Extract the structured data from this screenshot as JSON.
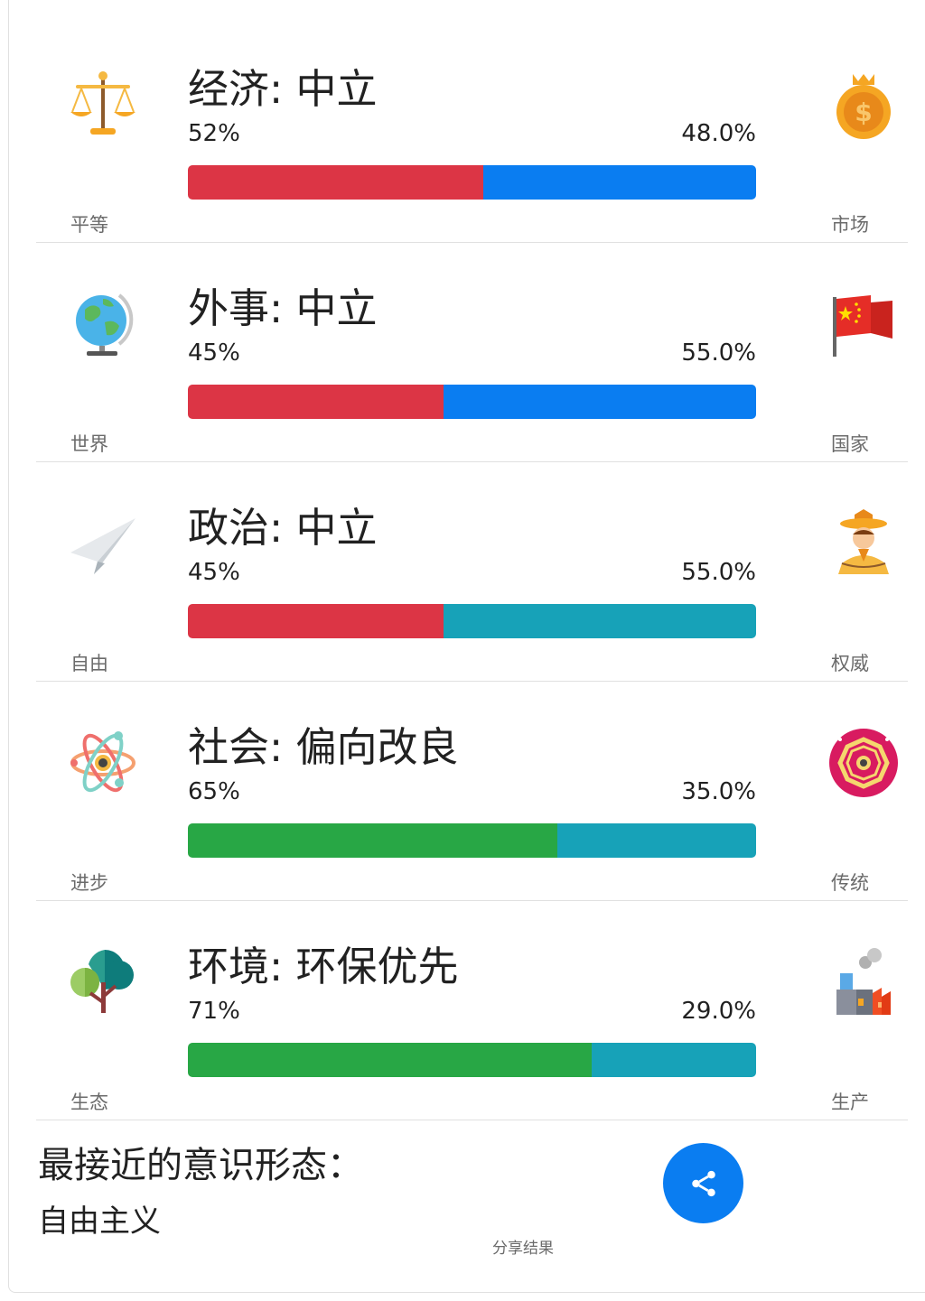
{
  "colors": {
    "red": "#dc3545",
    "blue": "#0a7df1",
    "teal": "#17a2b8",
    "green": "#28a745"
  },
  "axes": [
    {
      "title": "经济: 中立",
      "left_pct": "52%",
      "right_pct": "48.0%",
      "left_value": 52,
      "left_label": "平等",
      "right_label": "市场",
      "left_icon": "scales-icon",
      "right_icon": "money-bag-icon",
      "left_color": "#dc3545",
      "right_color": "#0a7df1"
    },
    {
      "title": "外事: 中立",
      "left_pct": "45%",
      "right_pct": "55.0%",
      "left_value": 45,
      "left_label": "世界",
      "right_label": "国家",
      "left_icon": "globe-icon",
      "right_icon": "flag-icon",
      "left_color": "#dc3545",
      "right_color": "#0a7df1"
    },
    {
      "title": "政治: 中立",
      "left_pct": "45%",
      "right_pct": "55.0%",
      "left_value": 45,
      "left_label": "自由",
      "right_label": "权威",
      "left_icon": "paper-plane-icon",
      "right_icon": "emperor-icon",
      "left_color": "#dc3545",
      "right_color": "#17a2b8"
    },
    {
      "title": "社会: 偏向改良",
      "left_pct": "65%",
      "right_pct": "35.0%",
      "left_value": 65,
      "left_label": "进步",
      "right_label": "传统",
      "left_icon": "atom-icon",
      "right_icon": "bagua-icon",
      "left_color": "#28a745",
      "right_color": "#17a2b8"
    },
    {
      "title": "环境: 环保优先",
      "left_pct": "71%",
      "right_pct": "29.0%",
      "left_value": 71,
      "left_label": "生态",
      "right_label": "生产",
      "left_icon": "tree-icon",
      "right_icon": "factory-icon",
      "left_color": "#28a745",
      "right_color": "#17a2b8"
    }
  ],
  "summary": {
    "title": "最接近的意识形态：",
    "value": "自由主义"
  },
  "share": {
    "label": "分享结果",
    "icon": "share-icon"
  }
}
